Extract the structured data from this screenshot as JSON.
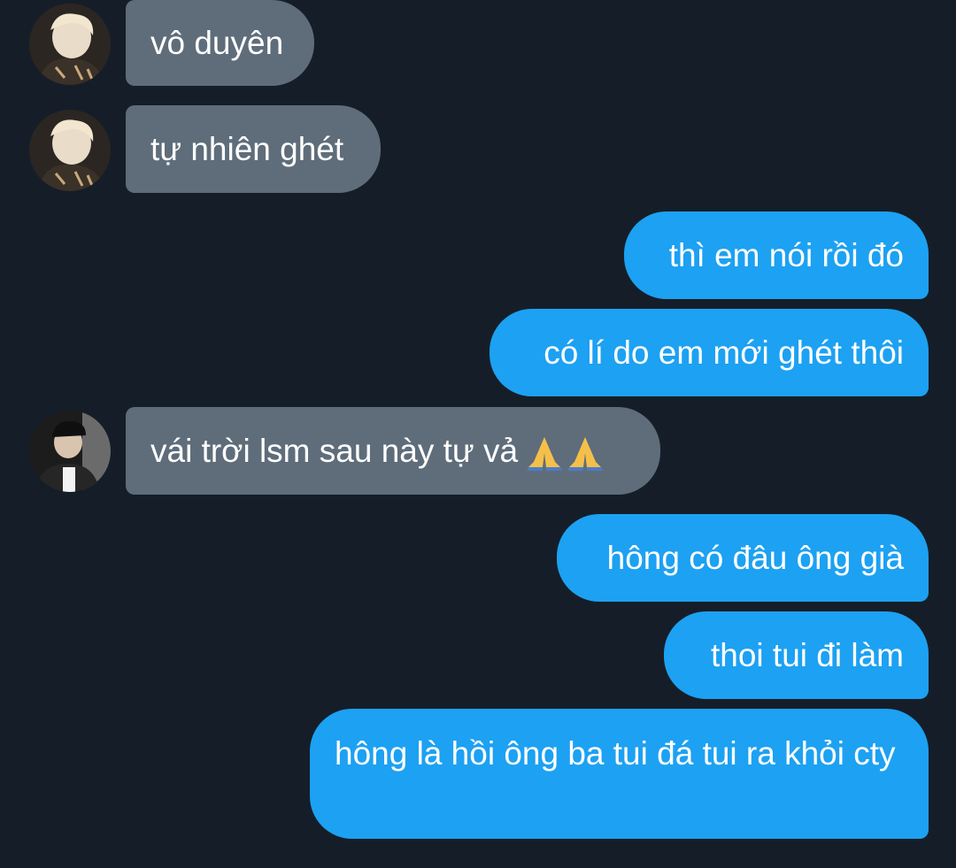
{
  "conversation": {
    "messages": [
      {
        "direction": "incoming",
        "sender": "user-a",
        "text": "vô duyên"
      },
      {
        "direction": "incoming",
        "sender": "user-a",
        "text": "tự nhiên ghét"
      },
      {
        "direction": "outgoing",
        "text": "thì em nói rồi đó"
      },
      {
        "direction": "outgoing",
        "text": "có lí do em mới ghét thôi"
      },
      {
        "direction": "incoming",
        "sender": "user-b",
        "text": "vái trời lsm sau này tự vả",
        "emoji": [
          "folded-hands-icon",
          "folded-hands-icon"
        ]
      },
      {
        "direction": "outgoing",
        "text": "hông có đâu ông già"
      },
      {
        "direction": "outgoing",
        "text": "thoi tui đi làm"
      },
      {
        "direction": "outgoing",
        "text": "hông là hồi ông ba tui đá tui ra khỏi cty"
      }
    ]
  },
  "colors": {
    "background": "#151e28",
    "incoming_bubble": "#5f6d7a",
    "outgoing_bubble": "#1da1f2",
    "text": "#ffffff"
  }
}
